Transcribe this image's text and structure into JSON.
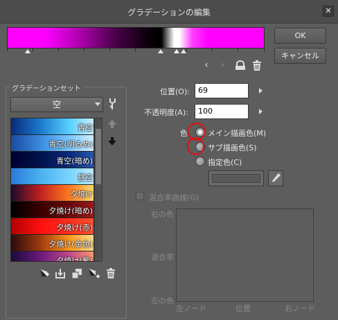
{
  "window": {
    "title": "グラデーションの編集"
  },
  "buttons": {
    "ok": "OK",
    "cancel": "キャンセル"
  },
  "preset_group": {
    "label": "グラデーションセット",
    "selected": "空",
    "items": [
      {
        "label": "青空",
        "colors": [
          "#0a2a7a",
          "#1a7acc",
          "#5ad0ff",
          "#cfefff"
        ]
      },
      {
        "label": "青空(明るめ)",
        "colors": [
          "#1a4aa0",
          "#3a8ae0",
          "#7ac8ff",
          "#d8f0ff"
        ]
      },
      {
        "label": "青空(暗め)",
        "colors": [
          "#000030",
          "#02124a",
          "#0a2a7a",
          "#2a5ab0"
        ]
      },
      {
        "label": "昼空",
        "colors": [
          "#2a7ad8",
          "#4ab0f0",
          "#7ad4ff",
          "#bfeaff"
        ]
      },
      {
        "label": "夕焼け",
        "colors": [
          "#1a0a2a",
          "#c02020",
          "#ff7a20",
          "#ffe070"
        ]
      },
      {
        "label": "夕焼け(暗め)",
        "colors": [
          "#000000",
          "#3a0000",
          "#6a0a0a",
          "#a01a1a"
        ]
      },
      {
        "label": "夕焼け(赤)",
        "colors": [
          "#b00000",
          "#ff1010",
          "#ff3020",
          "#ff5030"
        ]
      },
      {
        "label": "夕焼け(金色)",
        "colors": [
          "#2a0a0a",
          "#a03a10",
          "#ff9a20",
          "#ffe090"
        ]
      },
      {
        "label": "夕焼け(紫)",
        "colors": [
          "#1a0a3a",
          "#6a1a7a",
          "#c04a8a",
          "#ff9a6a"
        ]
      }
    ]
  },
  "position": {
    "label": "位置(O):",
    "value": "69"
  },
  "opacity": {
    "label": "不透明度(A):",
    "value": "100"
  },
  "color": {
    "label": "色",
    "options": [
      {
        "label": "メイン描画色(M)",
        "selected": true
      },
      {
        "label": "サブ描画色(S)",
        "selected": false
      },
      {
        "label": "指定色(C)",
        "selected": false
      }
    ]
  },
  "blend_curve": {
    "checkbox_label": "混合率曲線(G)",
    "right_color": "右の色",
    "blend_rate": "混合率",
    "left_color": "左の色",
    "left_node": "左ノード",
    "position": "位置",
    "right_node": "右ノード"
  },
  "icons": {
    "prev": "chevron-left-icon",
    "next": "chevron-right-icon",
    "lock": "lock-icon",
    "trash": "trash-icon",
    "settings": "wrench-icon"
  },
  "colors": {
    "gradient_start": "#ff00ff",
    "gradient_end": "#ff00ff",
    "annotation": "#e01010"
  }
}
